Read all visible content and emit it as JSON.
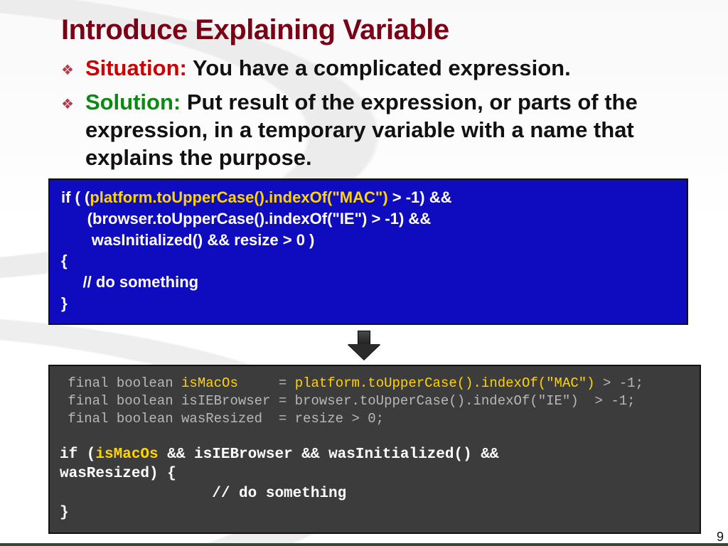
{
  "title": "Introduce Explaining Variable",
  "bullets": {
    "situation_label": "Situation:",
    "situation_text": " You have a complicated expression.",
    "solution_label": "Solution:",
    "solution_text": " Put result of the expression, or parts of the expression, in a temporary variable with a name that explains the purpose."
  },
  "code_before": {
    "l1a": "if ( (",
    "l1b": "platform.toUpperCase().indexOf(\"MAC\")",
    "l1c": " > -1) &&",
    "l2": "      (browser.toUpperCase().indexOf(\"IE\") > -1) &&",
    "l3": "       wasInitialized() && resize > 0 )",
    "l4": "{",
    "l5": "     // do something",
    "l6": "}"
  },
  "code_after": {
    "d1a": " final boolean ",
    "d1b": "isMacOs",
    "d1c": "     = ",
    "d1d": "platform.toUpperCase().indexOf(\"MAC\")",
    "d1e": " > -1;",
    "d2": " final boolean isIEBrowser = browser.toUpperCase().indexOf(\"IE\")  > -1;",
    "d3": " final boolean wasResized  = resize > 0;",
    "b1a": "if (",
    "b1b": "isMacOs",
    "b1c": " && isIEBrowser && wasInitialized() && ",
    "b2": "wasResized) {",
    "b3": "                 // do something",
    "b4": "}"
  },
  "page_number": "9"
}
